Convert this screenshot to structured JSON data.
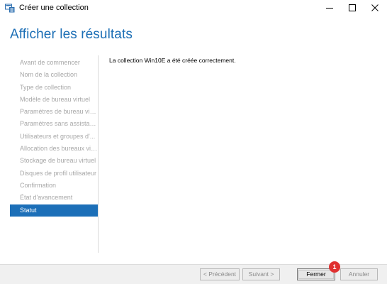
{
  "window": {
    "title": "Créer une collection",
    "controls": [
      "minimize-icon",
      "maximize-icon",
      "close-icon"
    ]
  },
  "header": {
    "title": "Afficher les résultats"
  },
  "nav": {
    "items": [
      {
        "label": "Avant de commencer",
        "active": false
      },
      {
        "label": "Nom de la collection",
        "active": false
      },
      {
        "label": "Type de collection",
        "active": false
      },
      {
        "label": "Modèle de bureau virtuel",
        "active": false
      },
      {
        "label": "Paramètres de bureau virt...",
        "active": false
      },
      {
        "label": "Paramètres sans assistance",
        "active": false
      },
      {
        "label": "Utilisateurs et groupes d'...",
        "active": false
      },
      {
        "label": "Allocation des bureaux vir...",
        "active": false
      },
      {
        "label": "Stockage de bureau virtuel",
        "active": false
      },
      {
        "label": "Disques de profil utilisateur",
        "active": false
      },
      {
        "label": "Confirmation",
        "active": false
      },
      {
        "label": "État d'avancement",
        "active": false
      },
      {
        "label": "Statut",
        "active": true
      }
    ]
  },
  "main": {
    "message": "La collection Win10E a été créée correctement."
  },
  "footer": {
    "previous_label": "< Précédent",
    "next_label": "Suivant >",
    "close_label": "Fermer",
    "cancel_label": "Annuler",
    "step_badge": "1"
  },
  "colors": {
    "accent": "#1c6fb8",
    "title": "#1b6eb5",
    "badge": "#e03131",
    "disabled_text": "#a8a8a8"
  }
}
